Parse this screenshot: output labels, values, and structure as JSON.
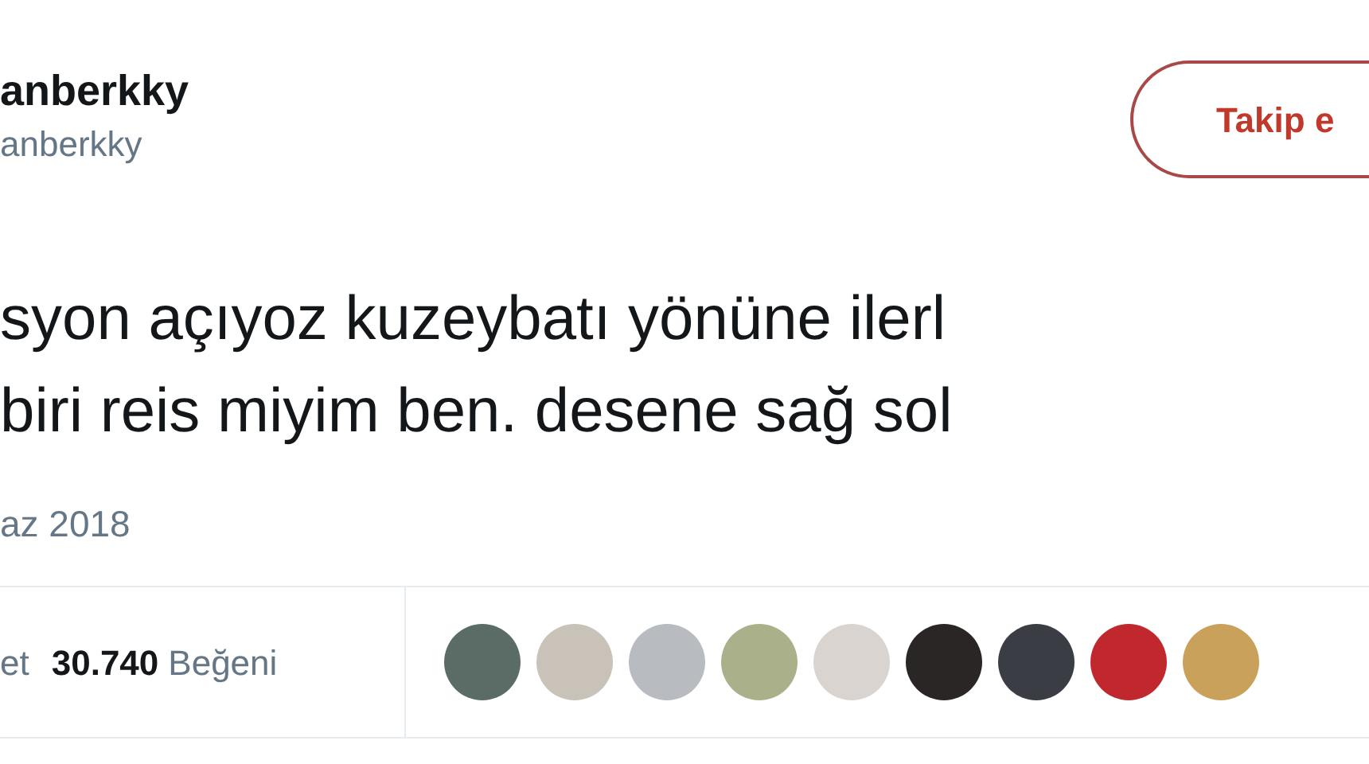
{
  "author": {
    "display_name": "anberkky",
    "handle": "anberkky"
  },
  "follow_button": {
    "label": "Takip e"
  },
  "tweet": {
    "lines": [
      "syon açıyoz kuzeybatı yönüne ilerl",
      "biri reis miyim ben. desene sağ sol"
    ],
    "date": "az 2018"
  },
  "stats": [
    {
      "label": "et"
    },
    {
      "count": "30.740",
      "label": "Beğeni"
    }
  ]
}
